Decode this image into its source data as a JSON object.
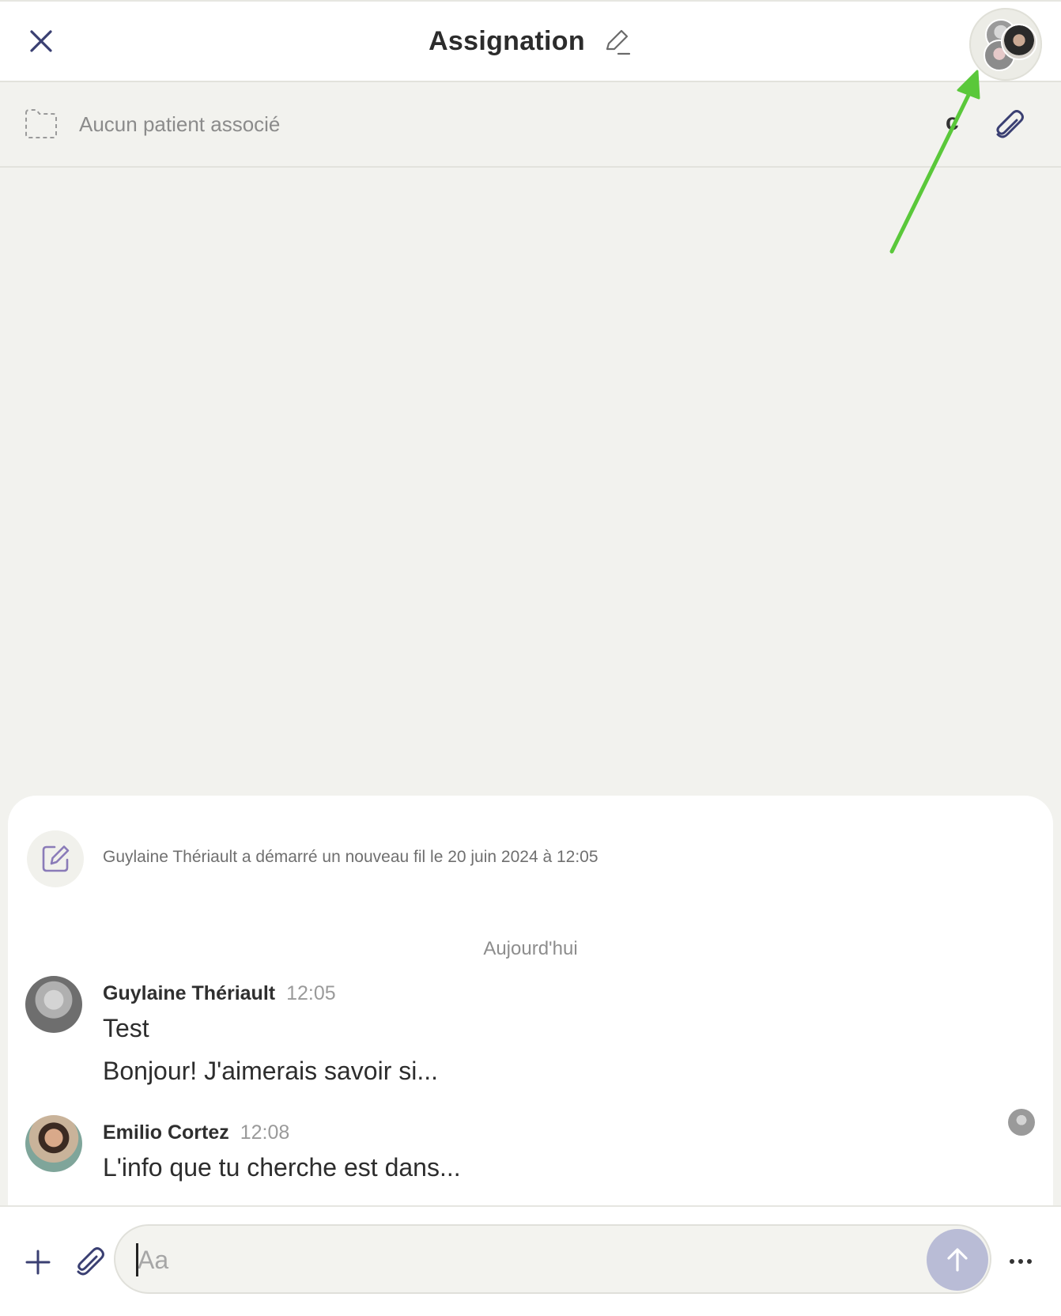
{
  "header": {
    "title": "Assignation",
    "close_icon": "close-icon",
    "edit_icon": "pencil-icon"
  },
  "subheader": {
    "patient_label": "Aucun patient associé",
    "folder_icon": "folder-icon",
    "attach_icon": "paperclip-icon",
    "partial_glyph": "c"
  },
  "thread": {
    "system_message": "Guylaine Thériault a démarré un nouveau fil le 20 juin 2024 à 12:05",
    "day_separator": "Aujourd'hui",
    "messages": [
      {
        "author": "Guylaine Thériault",
        "time": "12:05",
        "lines": [
          "Test",
          "Bonjour! J'aimerais savoir si..."
        ]
      },
      {
        "author": "Emilio Cortez",
        "time": "12:08",
        "lines": [
          "L'info que tu cherche est dans..."
        ]
      }
    ]
  },
  "composer": {
    "placeholder": "Aa",
    "value": "",
    "plus_icon": "plus-icon",
    "attach_icon": "paperclip-icon",
    "send_icon": "arrow-up-icon",
    "more_icon": "more-horizontal-icon"
  },
  "colors": {
    "background": "#f2f2ee",
    "accent": "#3a3f72",
    "send_button": "#b9bcd6",
    "annotation_arrow": "#5ac83a",
    "attach_icon": "#3a3f72"
  }
}
